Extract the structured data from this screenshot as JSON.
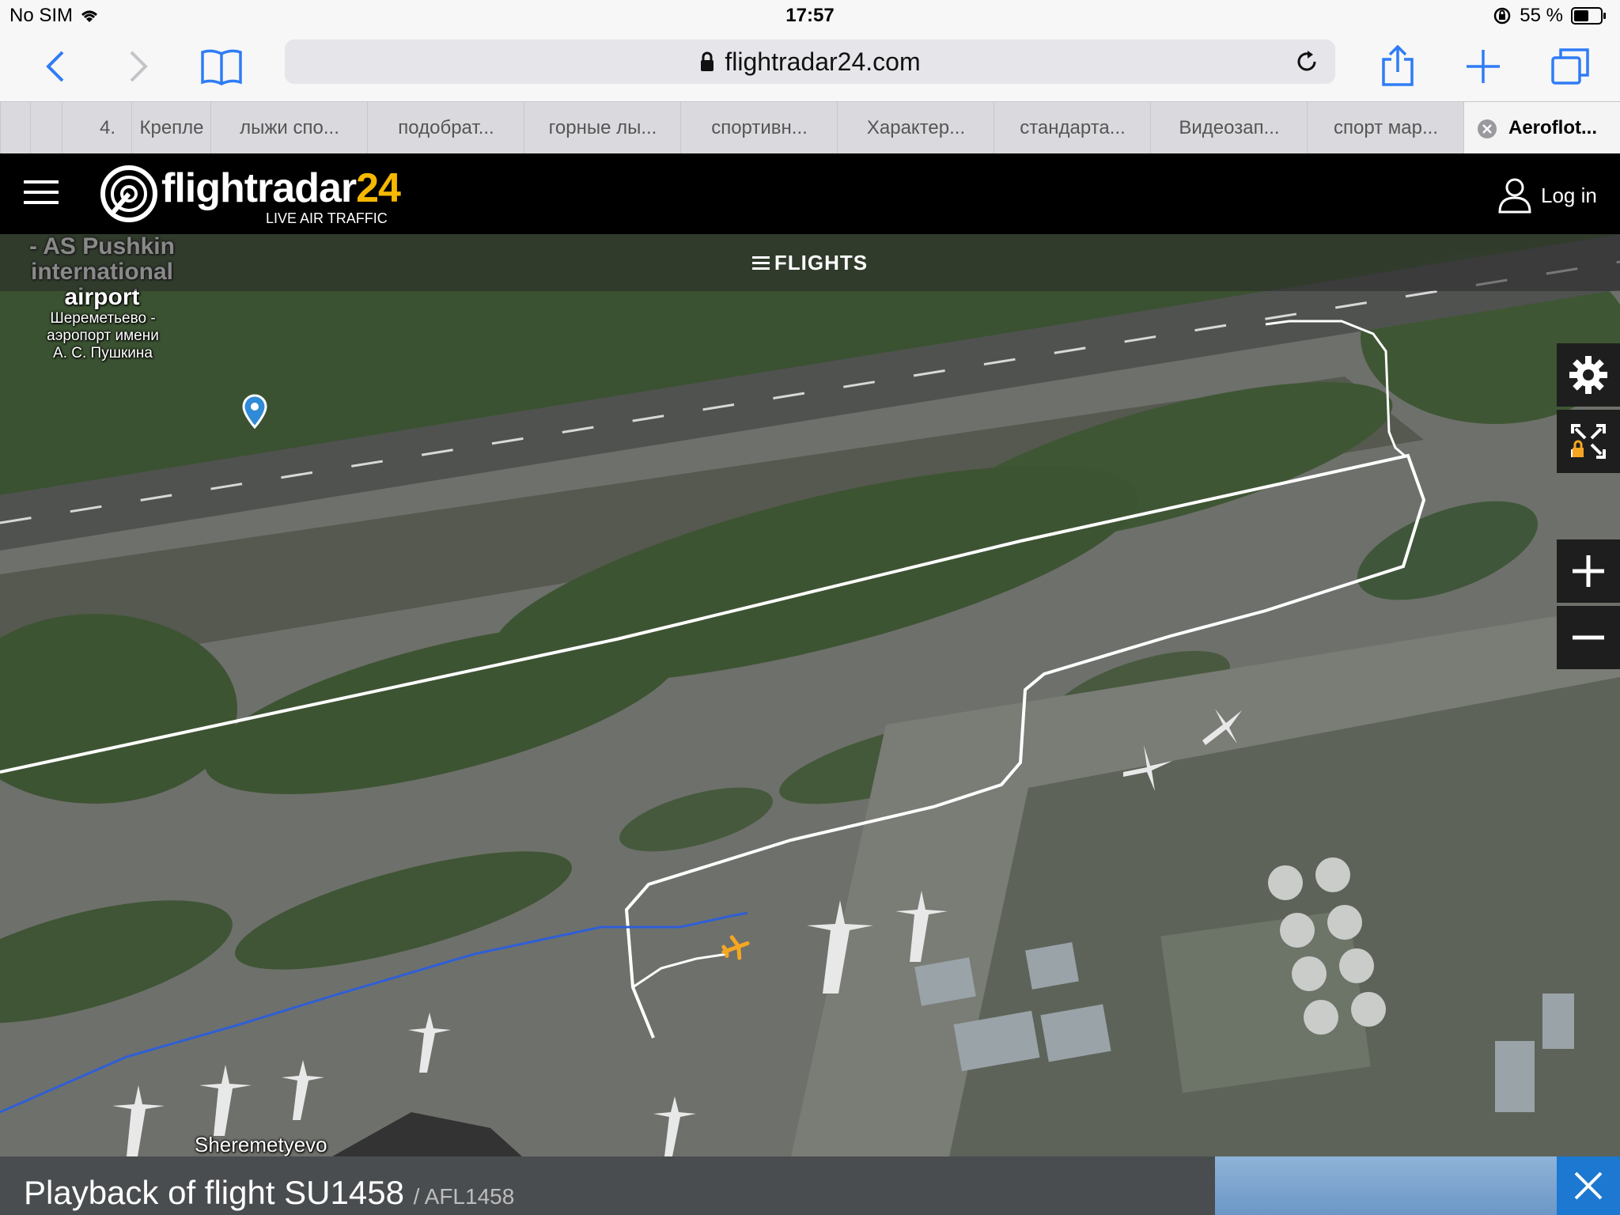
{
  "status_bar": {
    "carrier": "No SIM",
    "time": "17:57",
    "battery": "55 %"
  },
  "browser": {
    "url": "flightradar24.com",
    "tabs": [
      {
        "label": "4."
      },
      {
        "label": "Крепле"
      },
      {
        "label": "лыжи спо..."
      },
      {
        "label": "подобрат..."
      },
      {
        "label": "горные лы..."
      },
      {
        "label": "спортивн..."
      },
      {
        "label": "Характер..."
      },
      {
        "label": "стандарта..."
      },
      {
        "label": "Видеозап..."
      },
      {
        "label": "спорт мар..."
      },
      {
        "label": "Aeroflot..."
      }
    ]
  },
  "header": {
    "logo_main": "flightradar",
    "logo_num": "24",
    "logo_sub": "LIVE AIR TRAFFIC",
    "login_label": "Log in"
  },
  "flights_bar": {
    "label": "FLIGHTS"
  },
  "map": {
    "airport_label_en": "- AS Pushkin international airport",
    "airport_label_ru": "Шереметьево - аэропорт имени А. С. Пушкина",
    "place_label": "Sheremetyevo",
    "track_color": "#ffffff",
    "route_color": "#2f5fd6",
    "aircraft_color": "#f5a623"
  },
  "playback": {
    "title": "Playback of flight SU1458",
    "subtitle": "/ AFL1458"
  }
}
